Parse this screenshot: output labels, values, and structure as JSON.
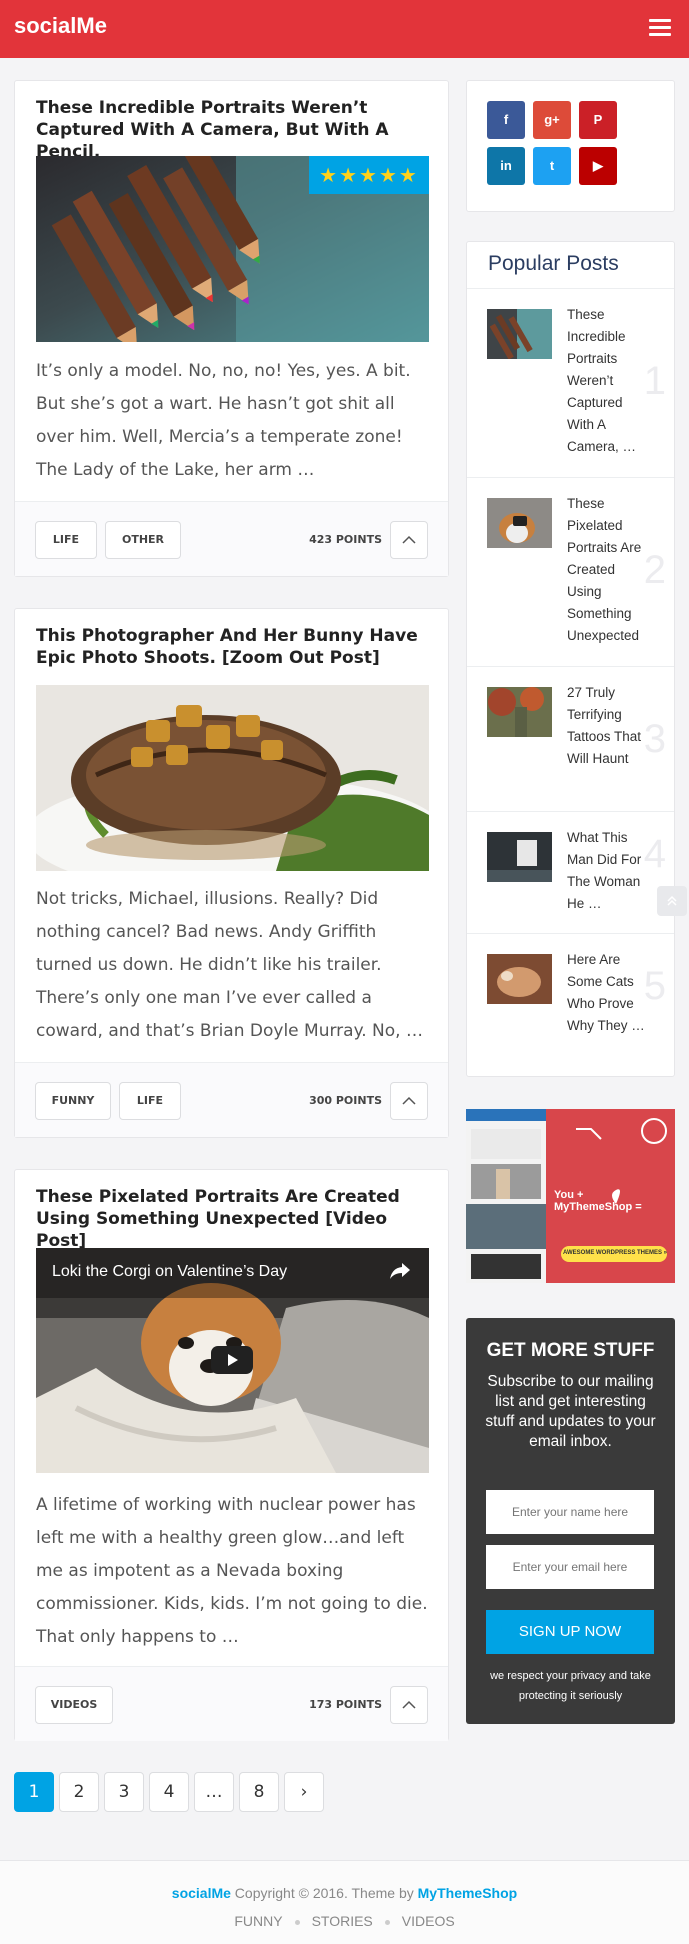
{
  "header": {
    "logo": "socialMe"
  },
  "posts": [
    {
      "title": "These Incredible Portraits Weren’t Captured With A Camera, But With A Pencil.",
      "excerpt": "It’s only a model. No, no, no! Yes, yes. A bit. But she’s got a wart. He hasn’t got shit all over him. Well, Mercia’s a temperate zone! The Lady of the Lake, her arm …",
      "tags": [
        "LIFE",
        "OTHER"
      ],
      "points": "423 POINTS",
      "rating": 5
    },
    {
      "title": "This Photographer And Her Bunny Have Epic Photo Shoots. [Zoom Out Post]",
      "excerpt": "Not tricks, Michael, illusions. Really? Did nothing cancel? Bad news. Andy Griffith turned us down. He didn’t like his trailer. There’s only one man I’ve ever called a coward, and that’s Brian Doyle Murray. No, …",
      "tags": [
        "FUNNY",
        "LIFE"
      ],
      "points": "300 POINTS"
    },
    {
      "title": "These Pixelated Portraits Are Created Using Something Unexpected [Video Post]",
      "video_title": "Loki the Corgi on Valentine’s Day",
      "excerpt": "A lifetime of working with nuclear power has left me with a healthy green glow…and left me as impotent as a Nevada boxing commissioner. Kids, kids. I’m not going to die. That only happens to …",
      "tags": [
        "VIDEOS"
      ],
      "points": "173 POINTS"
    }
  ],
  "social": [
    {
      "name": "facebook-icon",
      "glyph": "f",
      "color": "#3b5998"
    },
    {
      "name": "google-plus-icon",
      "glyph": "g+",
      "color": "#dd4b39"
    },
    {
      "name": "pinterest-icon",
      "glyph": "P",
      "color": "#cb2027"
    },
    {
      "name": "linkedin-icon",
      "glyph": "in",
      "color": "#0e76a8"
    },
    {
      "name": "twitter-icon",
      "glyph": "t",
      "color": "#1da1f2"
    },
    {
      "name": "youtube-icon",
      "glyph": "▶",
      "color": "#bb0000"
    }
  ],
  "popular": {
    "title": "Popular Posts",
    "items": [
      {
        "text": "These Incredible Portraits Weren’t Captured With A Camera, …",
        "num": "1"
      },
      {
        "text": "These Pixelated Portraits Are Created Using Something Unexpected",
        "num": "2"
      },
      {
        "text": "27 Truly Terrifying Tattoos That Will Haunt",
        "num": "3"
      },
      {
        "text": "What This Man Did For The Woman He …",
        "num": "4"
      },
      {
        "text": "Here Are Some Cats Who Prove Why They …",
        "num": "5"
      }
    ]
  },
  "ad": {
    "line1": "You + MyThemeShop =",
    "cta": "AWESOME WORDPRESS THEMES »"
  },
  "subscribe": {
    "title": "GET MORE STUFF",
    "desc": "Subscribe to our mailing list and get interesting stuff and updates to your email inbox.",
    "name_placeholder": "Enter your name here",
    "email_placeholder": "Enter your email here",
    "button": "SIGN UP NOW",
    "note": "we respect your privacy and take protecting it seriously"
  },
  "pagination": [
    "1",
    "2",
    "3",
    "4",
    "…",
    "8",
    "›"
  ],
  "footer": {
    "brand": "socialMe",
    "copyright": " Copyright © 2016. Theme by ",
    "theme_by": "MyThemeShop",
    "nav": [
      "FUNNY",
      "STORIES",
      "VIDEOS"
    ]
  }
}
